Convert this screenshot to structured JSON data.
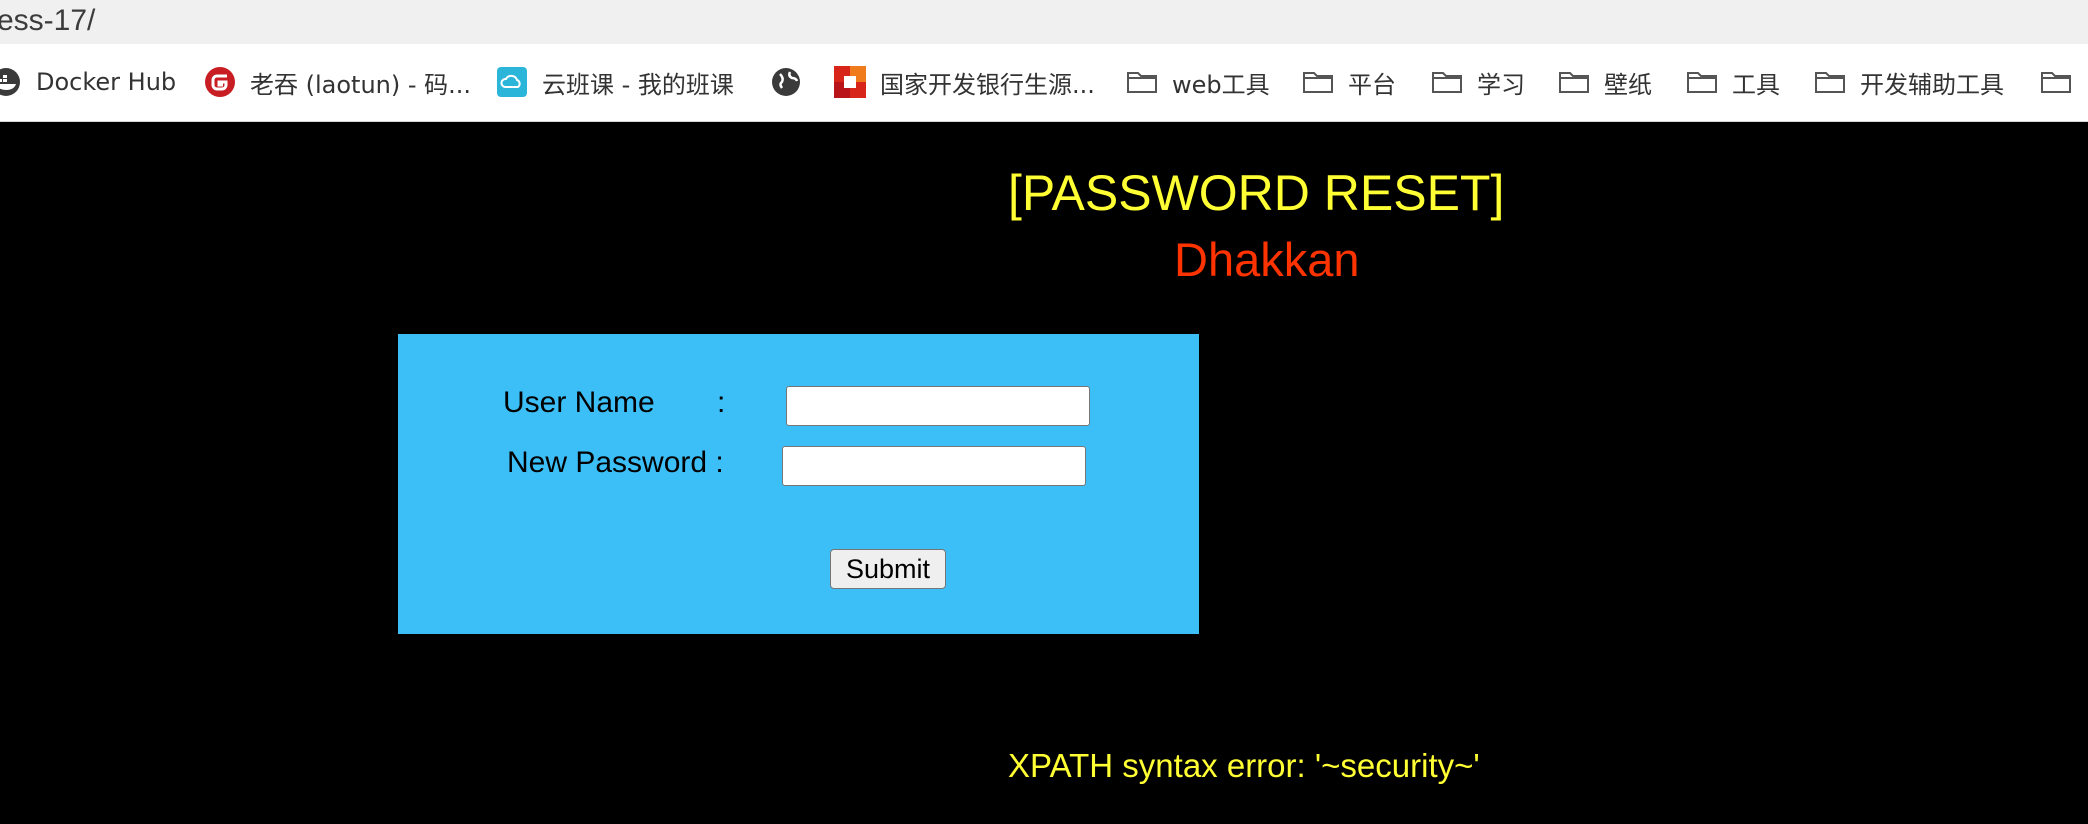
{
  "browser": {
    "url_fragment": "ess-17/",
    "bookmarks": [
      {
        "label": "Docker Hub",
        "icon": "docker-icon"
      },
      {
        "label": "老吞 (laotun) - 码...",
        "icon": "gitee-icon"
      },
      {
        "label": "云班课 - 我的班课",
        "icon": "cloud-class-icon"
      },
      {
        "label": "",
        "icon": "globe-icon"
      },
      {
        "label": "国家开发银行生源...",
        "icon": "cdb-icon"
      },
      {
        "label": "web工具",
        "icon": "folder-icon"
      },
      {
        "label": "平台",
        "icon": "folder-icon"
      },
      {
        "label": "学习",
        "icon": "folder-icon"
      },
      {
        "label": "壁纸",
        "icon": "folder-icon"
      },
      {
        "label": "工具",
        "icon": "folder-icon"
      },
      {
        "label": "开发辅助工具",
        "icon": "folder-icon"
      },
      {
        "label": "",
        "icon": "folder-icon"
      }
    ]
  },
  "page": {
    "title": "[PASSWORD RESET]",
    "subtitle": "Dhakkan",
    "form": {
      "username_label": "User Name",
      "username_colon": ":",
      "username_value": "",
      "password_label": "New Password :",
      "password_value": "",
      "submit_label": "Submit"
    },
    "error_message": "XPATH syntax error: '~security~'"
  },
  "colors": {
    "background": "#000000",
    "title": "#ffff33",
    "subtitle": "#ff3300",
    "form_background": "#3cbff7",
    "error": "#ffff33"
  }
}
